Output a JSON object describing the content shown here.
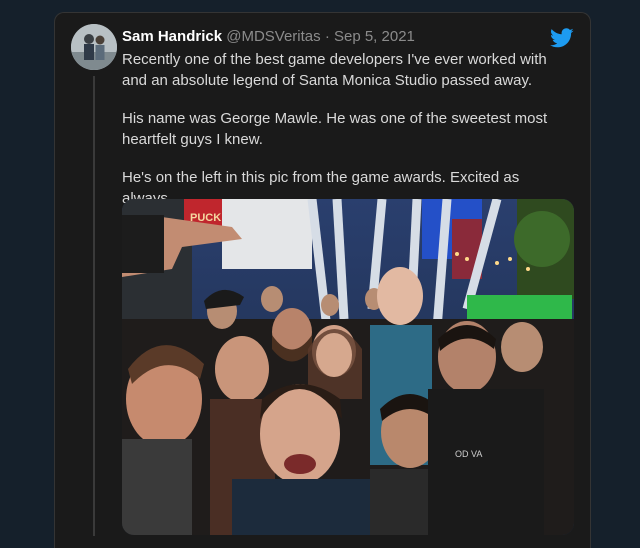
{
  "tweet": {
    "author_name": "Sam Handrick",
    "handle": "@MDSVeritas",
    "separator": "·",
    "date": "Sep 5, 2021",
    "paragraphs": [
      "Recently one of the best game developers I've ever worked with and an absolute legend of Santa Monica Studio passed away.",
      "His name was George Mawle. He was one of the sweetest most heartfelt guys I knew.",
      "He's on the left in this pic from the game awards. Excited as always."
    ]
  },
  "photo": {
    "sign_text": "PUCK",
    "shirt_text": "OD VA"
  },
  "colors": {
    "background": "#15202b",
    "card": "#1a1a1a",
    "twitter_blue": "#1d9bf0",
    "name": "#ffffff",
    "muted": "#8b8b8b"
  }
}
